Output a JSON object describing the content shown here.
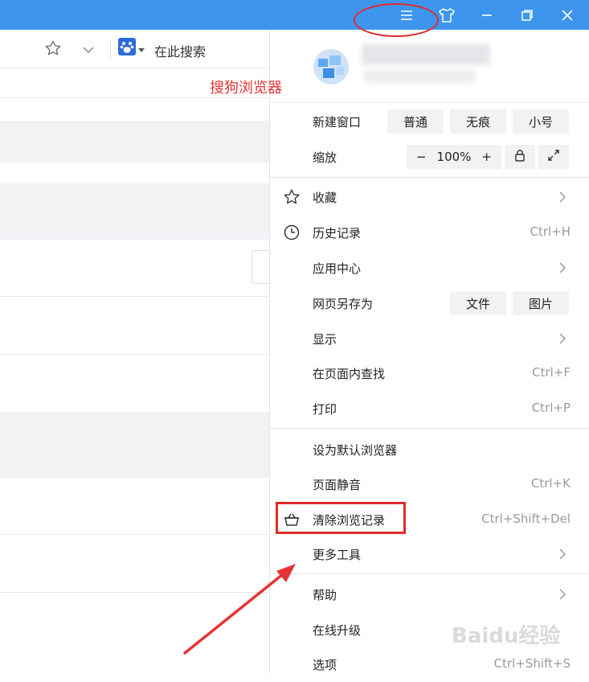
{
  "titlebar": {
    "color": "#3d95ee",
    "buttons": [
      {
        "name": "menu-icon"
      },
      {
        "name": "skin-icon"
      },
      {
        "name": "minimize-icon"
      },
      {
        "name": "restore-icon"
      },
      {
        "name": "close-icon"
      }
    ]
  },
  "toolbar": {
    "search_label": "在此搜索",
    "icons": [
      "star-icon",
      "chevron-down-icon",
      "baidu-paw-icon"
    ]
  },
  "annotation": {
    "note": "搜狗浏览器",
    "color": "#e53333"
  },
  "menu": {
    "new_window": {
      "label": "新建窗口",
      "options": [
        "普通",
        "无痕",
        "小号"
      ]
    },
    "zoom": {
      "label": "缩放",
      "minus": "−",
      "value": "100%",
      "plus": "+"
    },
    "items_a": [
      {
        "label": "收藏",
        "icon": "star-outline-icon",
        "chevron": true
      },
      {
        "label": "历史记录",
        "icon": "clock-icon",
        "shortcut": "Ctrl+H"
      },
      {
        "label": "应用中心",
        "chevron": true
      }
    ],
    "save_page": {
      "label": "网页另存为",
      "options": [
        "文件",
        "图片"
      ]
    },
    "items_b": [
      {
        "label": "显示",
        "chevron": true
      },
      {
        "label": "在页面内查找",
        "shortcut": "Ctrl+F"
      },
      {
        "label": "打印",
        "shortcut": "Ctrl+P"
      }
    ],
    "items_c": [
      {
        "label": "设为默认浏览器"
      },
      {
        "label": "页面静音",
        "shortcut": "Ctrl+K"
      },
      {
        "label": "清除浏览记录",
        "icon": "basket-icon",
        "shortcut": "Ctrl+Shift+Del"
      },
      {
        "label": "更多工具",
        "chevron": true
      }
    ],
    "items_d": [
      {
        "label": "帮助",
        "chevron": true
      },
      {
        "label": "在线升级"
      },
      {
        "label": "选项",
        "shortcut": "Ctrl+Shift+S"
      }
    ]
  },
  "watermark": "Baidu经验"
}
